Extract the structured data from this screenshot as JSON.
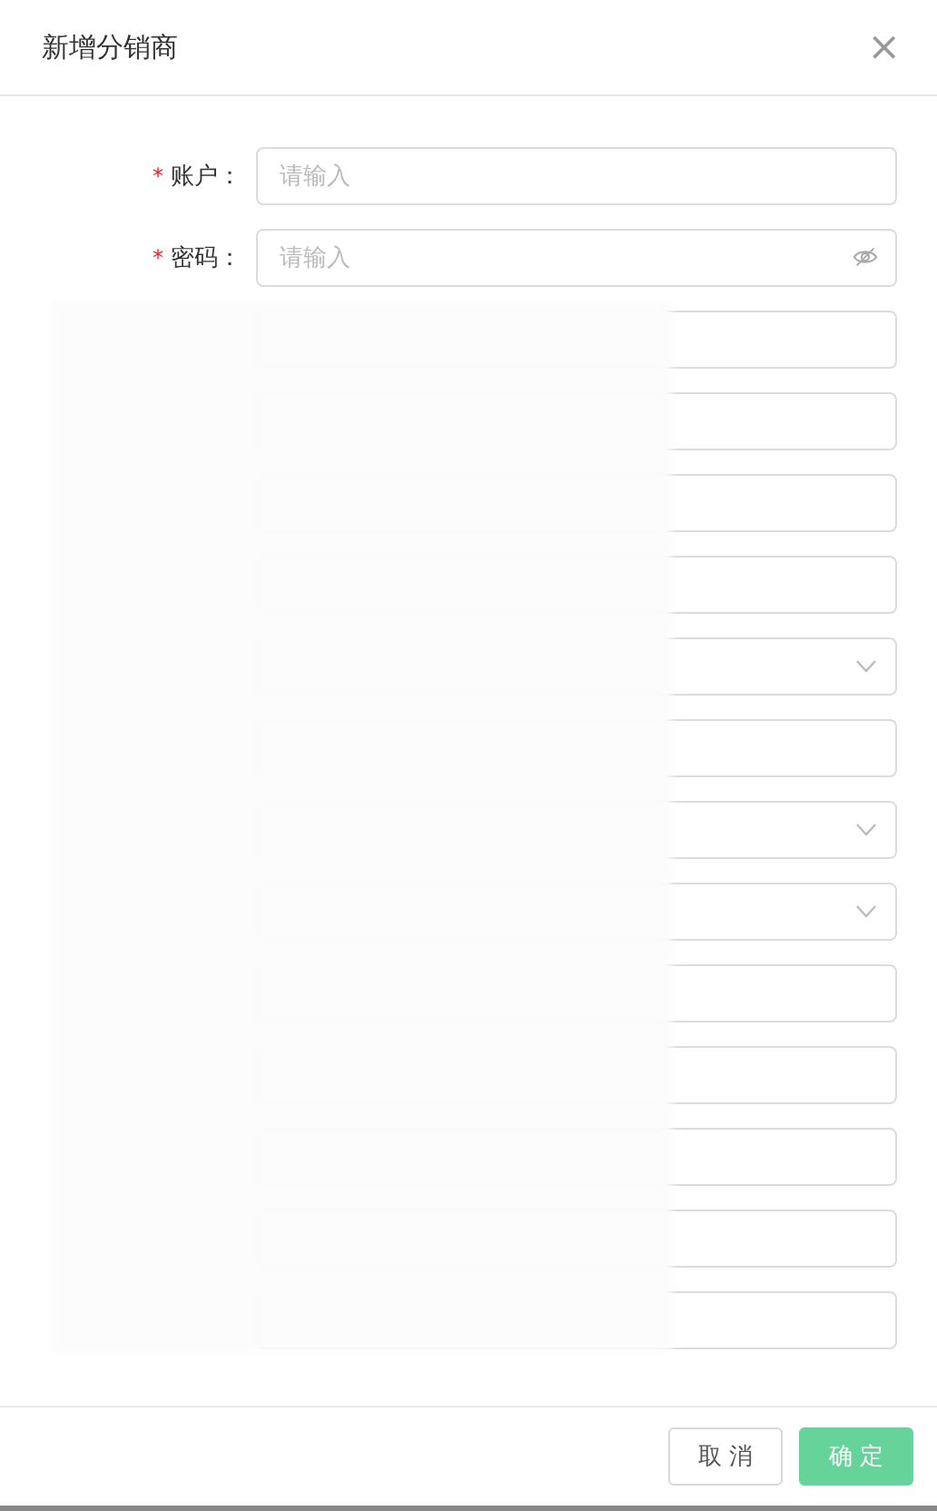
{
  "dialog": {
    "title": "新增分销商",
    "close": "×"
  },
  "fields": [
    {
      "label": "账户：",
      "required_mark": "*",
      "placeholder": "请输入",
      "kind": "text"
    },
    {
      "label": "密码：",
      "required_mark": "*",
      "placeholder": "请输入",
      "kind": "password"
    }
  ],
  "redacted_fields": [
    {
      "kind": "text"
    },
    {
      "kind": "text"
    },
    {
      "kind": "text"
    },
    {
      "kind": "text"
    },
    {
      "kind": "select"
    },
    {
      "kind": "text"
    },
    {
      "kind": "select"
    },
    {
      "kind": "select"
    },
    {
      "kind": "text"
    },
    {
      "kind": "text"
    },
    {
      "kind": "text"
    },
    {
      "kind": "text"
    },
    {
      "kind": "text"
    }
  ],
  "buttons": [
    {
      "label": "取 消",
      "kind": "default"
    },
    {
      "label": "确 定",
      "kind": "primary"
    }
  ]
}
